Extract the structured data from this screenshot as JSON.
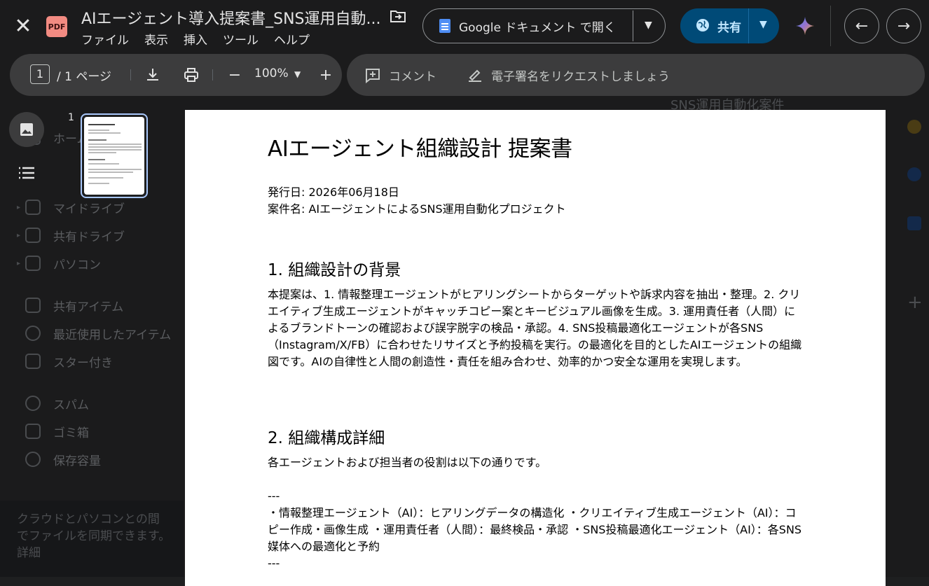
{
  "app": {
    "doc_title": "AIエージェント導入提案書_SNS運用自動...",
    "file_badge": "PDF",
    "menu": [
      "ファイル",
      "表示",
      "挿入",
      "ツール",
      "ヘルプ"
    ],
    "open_with_label": "Google ドキュメント で開く",
    "share_label": "共有"
  },
  "toolbar": {
    "page_current": "1",
    "page_total": "/ 1 ページ",
    "zoom": "100%",
    "comment_label": "コメント",
    "esign_label": "電子署名をリクエストしましょう"
  },
  "thumbnail": {
    "page_number": "1"
  },
  "background_drive": {
    "nav": [
      "ホーム",
      "マイドライブ",
      "共有ドライブ",
      "パソコン",
      "共有アイテム",
      "最近使用したアイテム",
      "スター付き",
      "スパム",
      "ゴミ箱",
      "保存容量"
    ],
    "sync_text": "クラウドとパソコンとの間でファイルを同期できます。",
    "sync_link": "詳細",
    "heading": "SNS運用自動化案件"
  },
  "document": {
    "title": "AIエージェント組織設計 提案書",
    "issue_date": "発行日: 2026年06月18日",
    "project_name": "案件名: AIエージェントによるSNS運用自動化プロジェクト",
    "section1_heading": "1. 組織設計の背景",
    "section1_body": "本提案は、1. 情報整理エージェントがヒアリングシートからターゲットや訴求内容を抽出・整理。2. クリエイティブ生成エージェントがキャッチコピー案とキービジュアル画像を生成。3. 運用責任者（人間）によるブランドトーンの確認および誤字脱字の検品・承認。4. SNS投稿最適化エージェントが各SNS（Instagram/X/FB）に合わせたリサイズと予約投稿を実行。の最適化を目的としたAIエージェントの組織図です。AIの自律性と人間の創造性・責任を組み合わせ、効率的かつ安全な運用を実現します。",
    "section2_heading": "2. 組織構成詳細",
    "section2_intro": "各エージェントおよび担当者の役割は以下の通りです。",
    "separator": "---",
    "roles_text": "・情報整理エージェント（AI）：ヒアリングデータの構造化 ・クリエイティブ生成エージェント（AI）：コピー作成・画像生成 ・運用責任者（人間）：最終検品・承認 ・SNS投稿最適化エージェント（AI）：各SNS媒体への最適化と予約",
    "separator2": "---"
  },
  "colors": {
    "background": "#1e1f20",
    "toolbar": "#3c3c3d",
    "share_button": "#004a77",
    "share_text": "#c2e7ff",
    "thumb_border": "#a8c7fa",
    "pdf_badge": "#f28b82"
  },
  "icons": [
    "close-icon",
    "pdf-file-icon",
    "move-to-folder-icon",
    "google-docs-icon",
    "chevron-down-icon",
    "globe-icon",
    "gemini-icon",
    "arrow-left-icon",
    "arrow-right-icon",
    "download-icon",
    "print-icon",
    "zoom-out-icon",
    "zoom-in-icon",
    "add-comment-icon",
    "signature-icon",
    "image-icon",
    "list-icon"
  ]
}
